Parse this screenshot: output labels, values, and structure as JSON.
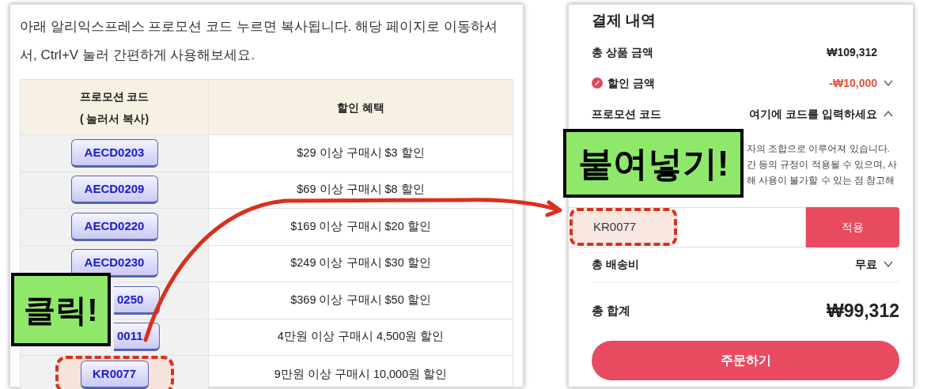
{
  "article": {
    "intro": "아래 알리익스프레스 프로모션 코드 누르면 복사됩니다. 해당 페이지로 이동하셔서, Ctrl+V 눌러 간편하게 사용해보세요.",
    "table": {
      "columns": [
        {
          "lines": [
            "프로모션 코드",
            "( 눌러서 복사)"
          ]
        },
        {
          "lines": [
            "할인 혜택"
          ]
        }
      ],
      "rows": [
        {
          "code": "AECD0203",
          "benefit": "$29 이상 구매시 $3 할인",
          "highlighted": false
        },
        {
          "code": "AECD0209",
          "benefit": "$69 이상 구매시 $8 할인",
          "highlighted": false
        },
        {
          "code": "AECD0220",
          "benefit": "$169 이상 구매시 $20 할인",
          "highlighted": false
        },
        {
          "code": "AECD0230",
          "benefit": "$249 이상 구매시 $30 할인",
          "highlighted": false
        },
        {
          "code": "0250",
          "benefit": "$369 이상 구매시 $50 할인",
          "highlighted": false,
          "cut": true
        },
        {
          "code": "0011",
          "benefit": "4만원 이상 구매시 4,500원 할인",
          "highlighted": false,
          "cut": true
        },
        {
          "code": "KR0077",
          "benefit": "9만원 이상 구매시 10,000원 할인",
          "highlighted": true
        }
      ]
    }
  },
  "payment": {
    "title": "결제 내역",
    "rows": [
      {
        "kind": "amount",
        "label": "총 상품 금액",
        "value": "₩109,312"
      },
      {
        "kind": "discount",
        "label": "할인 금액",
        "value": "-₩10,000",
        "expanded": false
      },
      {
        "kind": "promo",
        "label": "프로모션 코드",
        "value": "여기에 코드를 입력하세요",
        "expanded": true
      }
    ],
    "promo_notice": [
      "자의 조합으로 이루어져 있습니다.",
      "간 등의 규정이 적용될 수 있으며, 사",
      "해 사용이 불가할 수 있는 점 참고해"
    ],
    "promo_input": {
      "value": "KR0077",
      "highlighted": true
    },
    "apply_button": "적용",
    "shipping": {
      "label": "총 배송비",
      "value": "무료",
      "expanded": false
    },
    "total": {
      "label": "총 합계",
      "value": "₩99,312"
    },
    "order_button": "주문하기"
  },
  "annotations": [
    {
      "text": "클릭!"
    },
    {
      "text": "붙여넣기!"
    }
  ]
}
